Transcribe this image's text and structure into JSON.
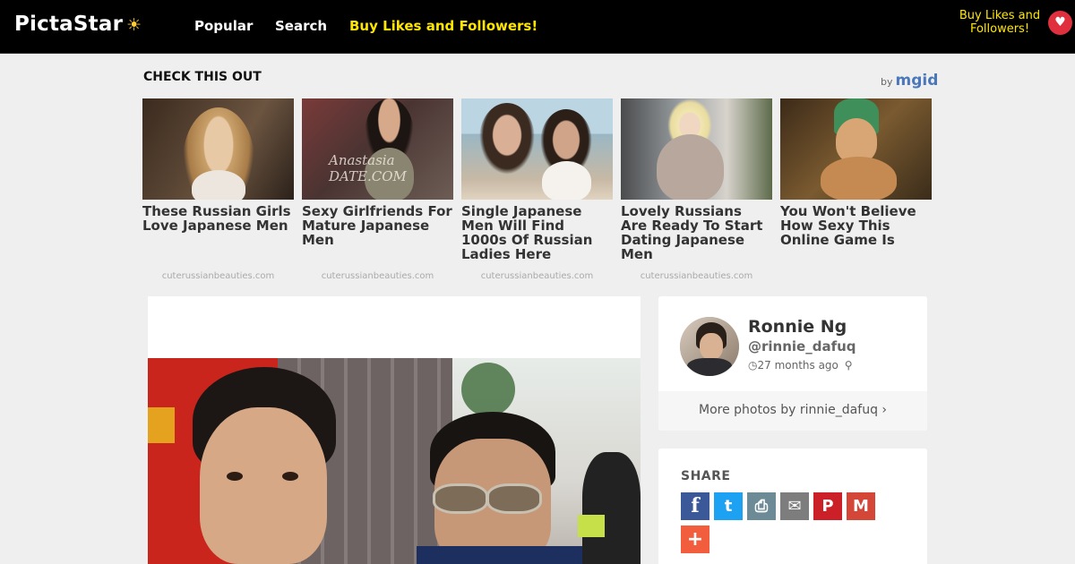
{
  "header": {
    "logo": "PictaStar",
    "logo_icon": "sun-icon",
    "nav": [
      {
        "label": "Popular"
      },
      {
        "label": "Search"
      },
      {
        "label": "Buy Likes and Followers!"
      }
    ],
    "buy_right_line1": "Buy Likes and",
    "buy_right_line2": "Followers!",
    "heart_icon": "heart-icon"
  },
  "ads": {
    "title": "CHECK THIS OUT",
    "by": "by",
    "brand": "mgid",
    "items": [
      {
        "headline": "These Russian Girls Love Japanese Men",
        "source": "cuterussianbeauties.com"
      },
      {
        "headline": "Sexy Girlfriends For Mature Japanese Men",
        "source": "cuterussianbeauties.com"
      },
      {
        "headline": "Single Japanese Men Will Find 1000s Of Russian Ladies Here",
        "source": "cuterussianbeauties.com"
      },
      {
        "headline": "Lovely Russians Are Ready To Start Dating Japanese Men",
        "source": "cuterussianbeauties.com"
      },
      {
        "headline": "You Won't Believe How Sexy This Online Game Is",
        "source": ""
      }
    ],
    "watermark": "Anastasia DATE.COM"
  },
  "profile": {
    "name": "Ronnie Ng",
    "username": "@rinnie_dafuq",
    "posted": "27 months ago",
    "more_photos": "More photos by rinnie_dafuq ›"
  },
  "share": {
    "title": "SHARE",
    "buttons": [
      {
        "name": "facebook",
        "glyph": "f",
        "color": "#3b5998"
      },
      {
        "name": "twitter",
        "glyph": "t",
        "color": "#1da1f2"
      },
      {
        "name": "print",
        "glyph": "⎙",
        "color": "#6d8b96"
      },
      {
        "name": "email",
        "glyph": "✉",
        "color": "#7d7d7d"
      },
      {
        "name": "pinterest",
        "glyph": "P",
        "color": "#cb2027"
      },
      {
        "name": "gmail",
        "glyph": "M",
        "color": "#d44638"
      },
      {
        "name": "more",
        "glyph": "+",
        "color": "#f25e3d"
      }
    ]
  }
}
